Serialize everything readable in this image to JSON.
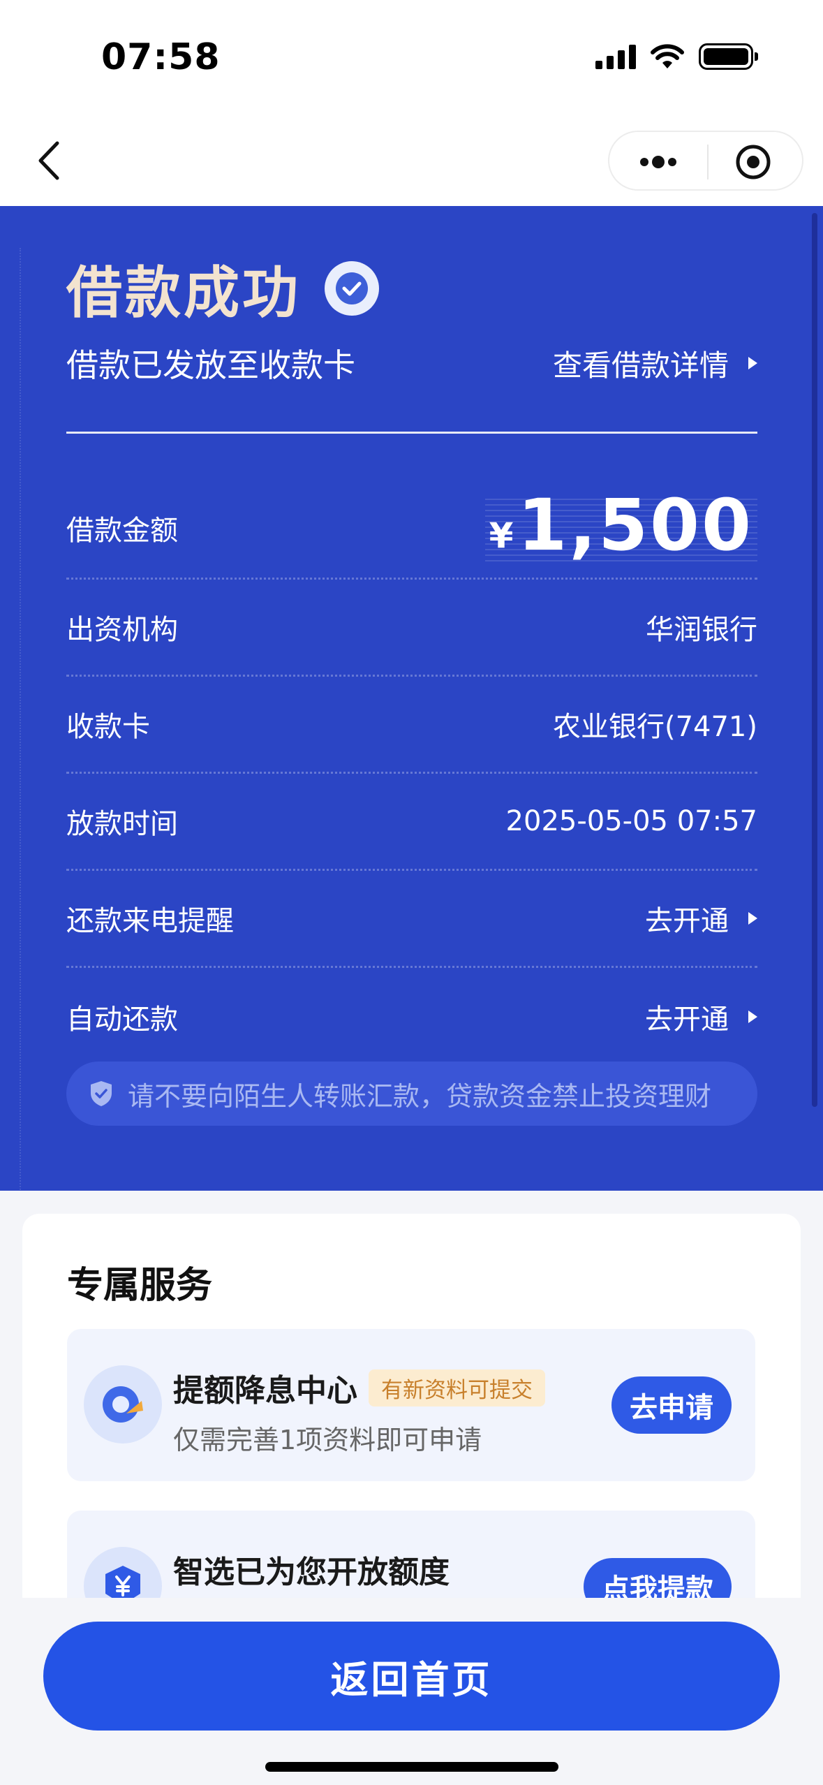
{
  "status_bar": {
    "time": "07:58"
  },
  "hero": {
    "title": "借款成功",
    "subtitle": "借款已发放至收款卡",
    "detail_link": "查看借款详情",
    "amount_label": "借款金额",
    "currency": "¥",
    "amount": "1,500",
    "rows": [
      {
        "label": "出资机构",
        "value": "华润银行"
      },
      {
        "label": "收款卡",
        "value": "农业银行(7471)"
      },
      {
        "label": "放款时间",
        "value": "2025-05-05 07:57"
      },
      {
        "label": "还款来电提醒",
        "value": "去开通"
      },
      {
        "label": "自动还款",
        "value": "去开通"
      }
    ],
    "notice": "请不要向陌生人转账汇款，贷款资金禁止投资理财"
  },
  "services": {
    "title": "专属服务",
    "items": [
      {
        "name": "提额降息中心",
        "tag": "有新资料可提交",
        "desc": "仅需完善1项资料即可申请",
        "button": "去申请"
      },
      {
        "name": "智选已为您开放额度",
        "button": "点我提款"
      }
    ]
  },
  "footer": {
    "home_button": "返回首页"
  },
  "colors": {
    "hero_bg": "#2b45c5",
    "primary_button": "#2453e6",
    "title_gold": "#f3e3cf",
    "tag_orange": "#c8802c"
  }
}
